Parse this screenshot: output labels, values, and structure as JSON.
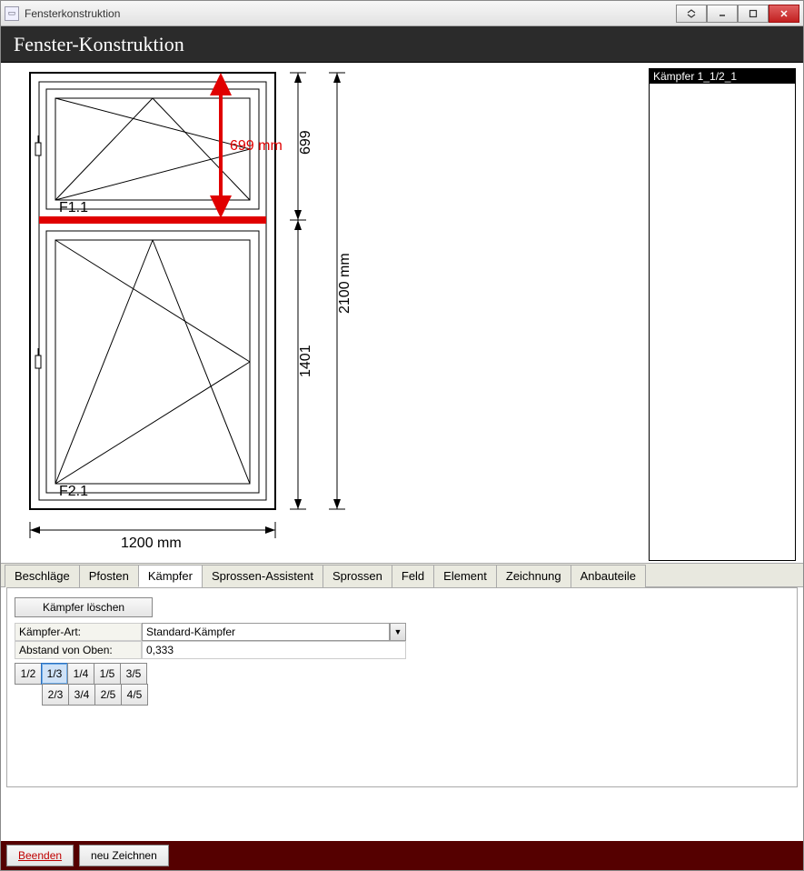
{
  "window": {
    "title": "Fensterkonstruktion"
  },
  "header": {
    "title": "Fenster-Konstruktion"
  },
  "side_panel": {
    "selected_item": "Kämpfer 1_1/2_1"
  },
  "drawing": {
    "width_label": "1200 mm",
    "total_height_label": "2100 mm",
    "top_height_label": "699",
    "bottom_height_label": "1401",
    "red_dim_label": "699 mm",
    "field_top": "F1.1",
    "field_bottom": "F2.1"
  },
  "tabs": {
    "items": [
      "Beschläge",
      "Pfosten",
      "Kämpfer",
      "Sprossen-Assistent",
      "Sprossen",
      "Feld",
      "Element",
      "Zeichnung",
      "Anbauteile"
    ],
    "active_index": 2
  },
  "kaempfer_panel": {
    "delete_label": "Kämpfer löschen",
    "art_label": "Kämpfer-Art:",
    "art_value": "Standard-Kämpfer",
    "abstand_label": "Abstand von Oben:",
    "abstand_value": "0,333",
    "fracs_row1": [
      "1/2",
      "1/3",
      "1/4",
      "1/5",
      "3/5"
    ],
    "fracs_row2": [
      "2/3",
      "3/4",
      "2/5",
      "4/5"
    ],
    "selected_frac": "1/3"
  },
  "footer": {
    "beenden": "Beenden",
    "neu": "neu Zeichnen"
  }
}
